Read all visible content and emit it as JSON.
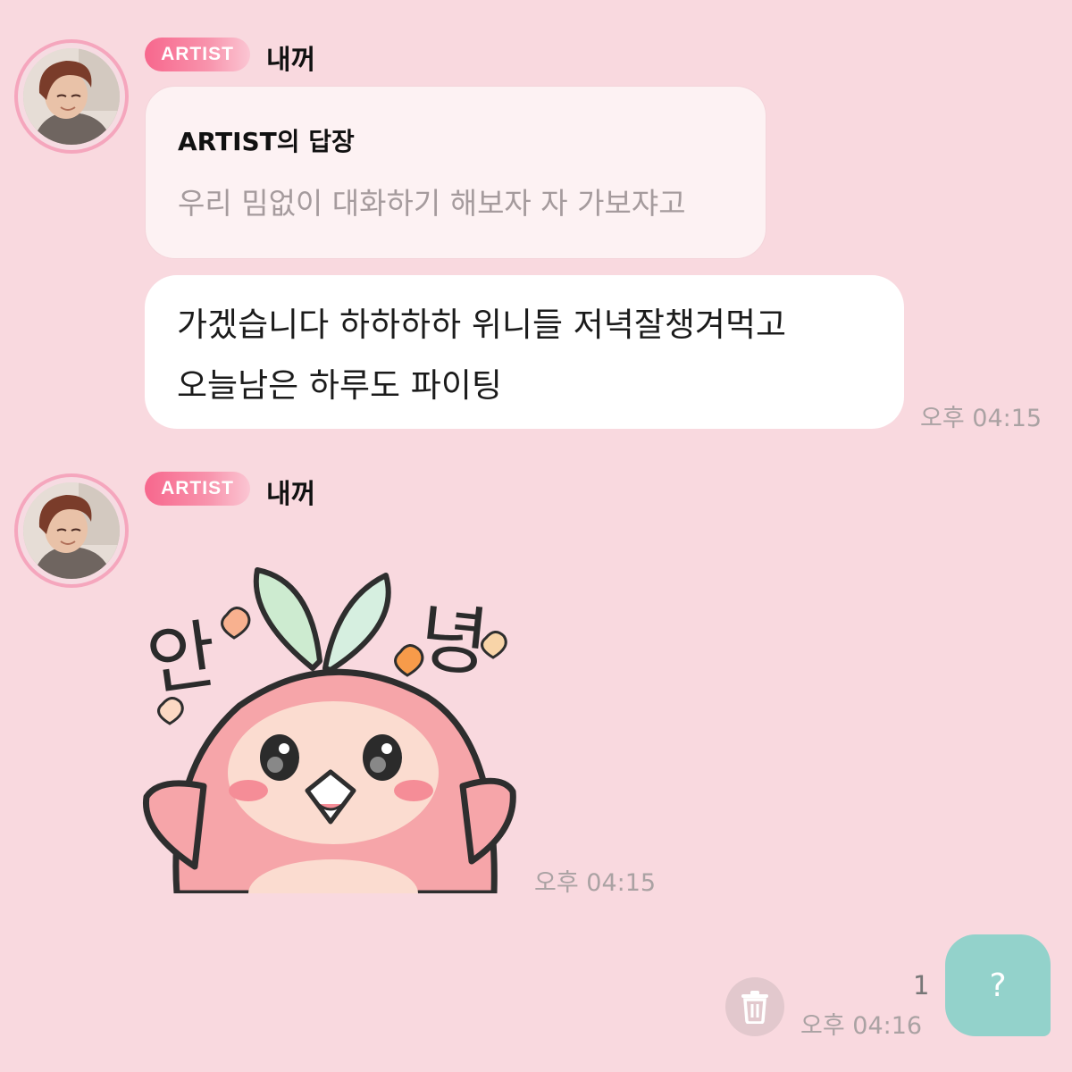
{
  "messages": [
    {
      "badge": "ARTIST",
      "sender": "내꺼",
      "reply": {
        "title": "ARTIST의 답장",
        "text": "우리 밈없이 대화하기 해보자 자 가보쟈고"
      },
      "lines": [
        "가겠습니다 하하하하 위니들 저녁잘챙겨먹고",
        "오늘남은 하루도 파이팅"
      ],
      "time": "오후 04:15"
    },
    {
      "badge": "ARTIST",
      "sender": "내꺼",
      "sticker": {
        "icon": "pink-bird-hello-sticker",
        "text_left": "안",
        "text_right": "녕"
      },
      "time": "오후 04:15"
    }
  ],
  "my_message": {
    "text": "?",
    "unread": "1",
    "time": "오후 04:16"
  },
  "colors": {
    "background": "#f9d9df",
    "badge": "#f7678d",
    "my_bubble": "#93d2cb"
  }
}
